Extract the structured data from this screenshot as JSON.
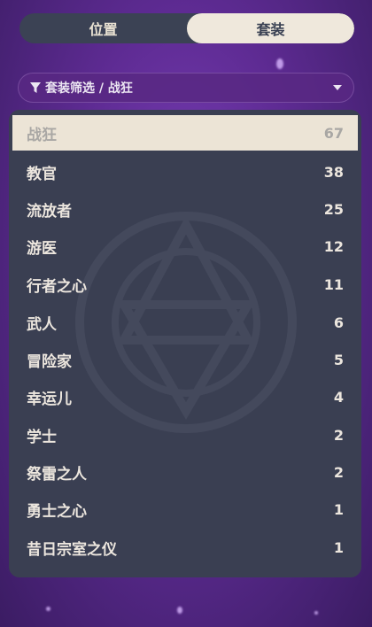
{
  "tabs": [
    {
      "label": "位置",
      "active": false
    },
    {
      "label": "套装",
      "active": true
    }
  ],
  "filter": {
    "label": "套装筛选 / 战狂",
    "icon": "filter-icon",
    "dropdown_icon": "caret-down-icon"
  },
  "sets": [
    {
      "name": "战狂",
      "count": "67",
      "selected": true
    },
    {
      "name": "教官",
      "count": "38",
      "selected": false
    },
    {
      "name": "流放者",
      "count": "25",
      "selected": false
    },
    {
      "name": "游医",
      "count": "12",
      "selected": false
    },
    {
      "name": "行者之心",
      "count": "11",
      "selected": false
    },
    {
      "name": "武人",
      "count": "6",
      "selected": false
    },
    {
      "name": "冒险家",
      "count": "5",
      "selected": false
    },
    {
      "name": "幸运儿",
      "count": "4",
      "selected": false
    },
    {
      "name": "学士",
      "count": "2",
      "selected": false
    },
    {
      "name": "祭雷之人",
      "count": "2",
      "selected": false
    },
    {
      "name": "勇士之心",
      "count": "1",
      "selected": false
    },
    {
      "name": "昔日宗室之仪",
      "count": "1",
      "selected": false
    }
  ],
  "colors": {
    "panel": "#3a3f52",
    "selected_row": "#ece4d6",
    "tab_active": "#efe8dc",
    "tab_inactive": "#3b4254",
    "background": "#5e2b93"
  }
}
